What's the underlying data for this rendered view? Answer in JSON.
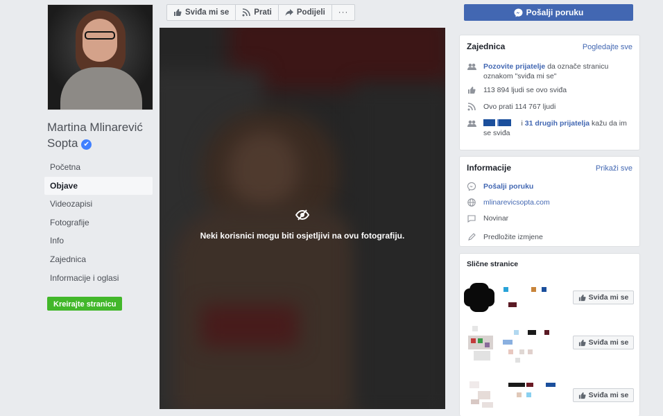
{
  "profile": {
    "name": "Martina Mlinarević Sopta",
    "verified": "✔"
  },
  "nav": {
    "items": [
      "Početna",
      "Objave",
      "Videozapisi",
      "Fotografije",
      "Info",
      "Zajednica",
      "Informacije i oglasi"
    ],
    "active": "Objave"
  },
  "create_page_label": "Kreirajte stranicu",
  "actions": {
    "like": "Sviđa mi se",
    "follow": "Prati",
    "share": "Podijeli",
    "more": "···"
  },
  "send_message": "Pošalji poruku",
  "photo": {
    "warning": "Neki korisnici mogu biti osjetljivi na ovu fotografiju."
  },
  "community": {
    "title": "Zajednica",
    "see_all": "Pogledajte sve",
    "invite_link": "Pozovite prijatelje",
    "invite_text": " da označe stranicu oznakom \"sviđa mi se\"",
    "likes": "113 894 ljudi se ovo sviđa",
    "follows": "Ovo prati 114 767 ljudi",
    "friends_prefix": "i ",
    "friends_link": "31 drugih prijatelja",
    "friends_suffix": " kažu da im se sviđa"
  },
  "info": {
    "title": "Informacije",
    "show_all": "Prikaži sve",
    "send_message": "Pošalji poruku",
    "website": "mlinarevicsopta.com",
    "category": "Novinar",
    "suggest_edits": "Predložite izmjene"
  },
  "similar": {
    "title": "Slične stranice",
    "like_label": "Sviđa mi se"
  },
  "colors": {
    "brand": "#4267b2",
    "create_green": "#42b72a",
    "verified": "#4080ff"
  }
}
